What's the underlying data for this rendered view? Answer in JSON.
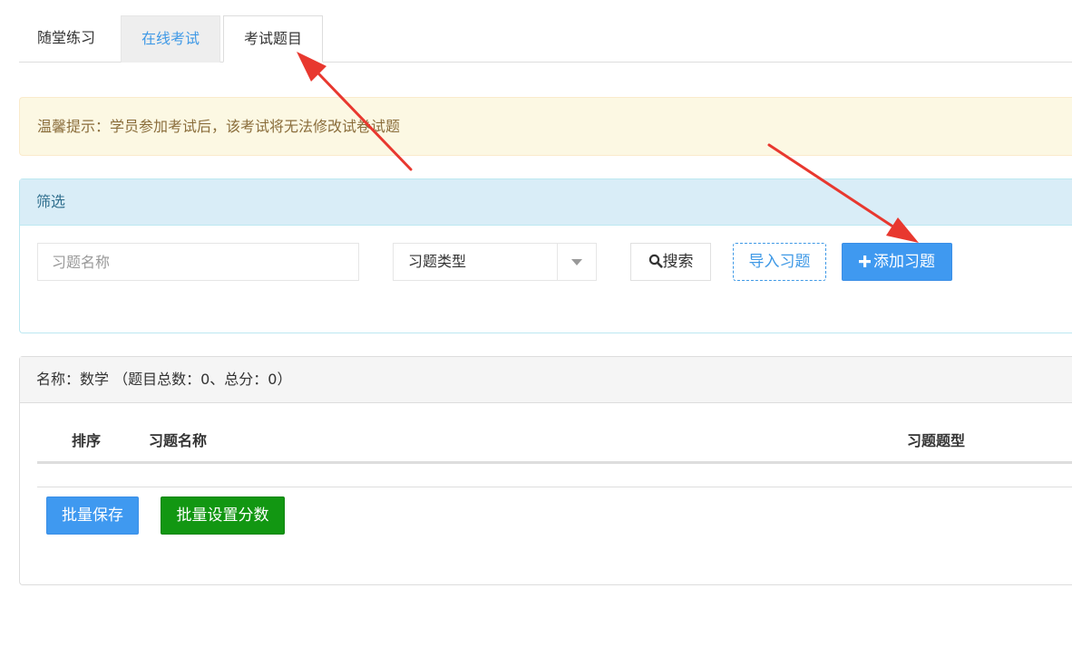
{
  "tabs": [
    {
      "label": "随堂练习"
    },
    {
      "label": "在线考试"
    },
    {
      "label": "考试题目"
    }
  ],
  "notice": {
    "text": "温馨提示：学员参加考试后，该考试将无法修改试卷试题"
  },
  "filter": {
    "title": "筛选",
    "name_placeholder": "习题名称",
    "type_select": {
      "value": "习题类型"
    },
    "search_label": "搜索",
    "import_label": "导入习题",
    "add_label": "添加习题"
  },
  "list": {
    "header": "名称：数学 （题目总数：0、总分：0）",
    "columns": {
      "order": "排序",
      "name": "习题名称",
      "type": "习题题型"
    },
    "batch_save_label": "批量保存",
    "batch_score_label": "批量设置分数"
  },
  "colors": {
    "primary": "#3f99f0",
    "success": "#129712",
    "annotation_arrow": "#e8382f"
  },
  "icons": {
    "search": "search-icon",
    "add": "plus-icon",
    "dropdown": "caret-down-icon"
  }
}
